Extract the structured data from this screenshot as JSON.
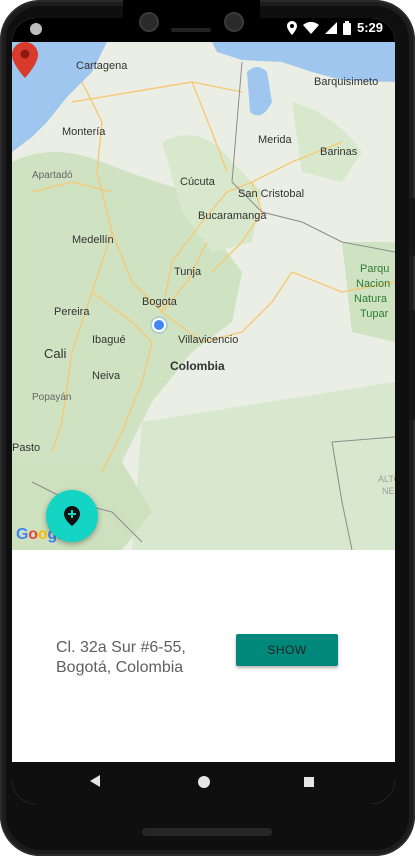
{
  "status_bar": {
    "time": "5:29",
    "icons": [
      "location-icon",
      "wifi-icon",
      "signal-icon",
      "battery-icon"
    ]
  },
  "map": {
    "cities": {
      "cartagena": "Cartagena",
      "barquisimeto": "Barquisimeto",
      "monteria": "Montería",
      "merida": "Merida",
      "barinas": "Barinas",
      "apartado": "Apartadó",
      "cucuta": "Cúcuta",
      "san_cristobal": "San Cristobal",
      "bucaramanga": "Bucaramanga",
      "medellin": "Medellín",
      "tunja": "Tunja",
      "pereira": "Pereira",
      "bogota": "Bogota",
      "villavicencio": "Villavicencio",
      "ibague": "Ibagué",
      "cali": "Cali",
      "neiva": "Neiva",
      "popayan": "Popayán",
      "pasto": "Pasto"
    },
    "country": "Colombia",
    "park": [
      "Parqu",
      "Nacion",
      "Natura",
      "Tupar"
    ],
    "ghost_labels": [
      "ALTO",
      "NE"
    ],
    "logo_letters": [
      "G",
      "o",
      "o",
      "g",
      "l",
      "e"
    ],
    "colors": {
      "land": "#eaeee4",
      "green": "#cfe3c3",
      "water": "#9fc6ef",
      "road": "#f6c978",
      "marker": "#d93a2b"
    }
  },
  "fab": {
    "icon": "add-location-icon",
    "color": "#14d5c4"
  },
  "bottom": {
    "address": "Cl. 32a Sur #6-55, Bogotá, Colombia",
    "show_label": "SHOW",
    "button_color": "#00897b"
  },
  "navigation": {
    "back": "back-icon",
    "home": "home-icon",
    "recents": "recents-icon"
  }
}
